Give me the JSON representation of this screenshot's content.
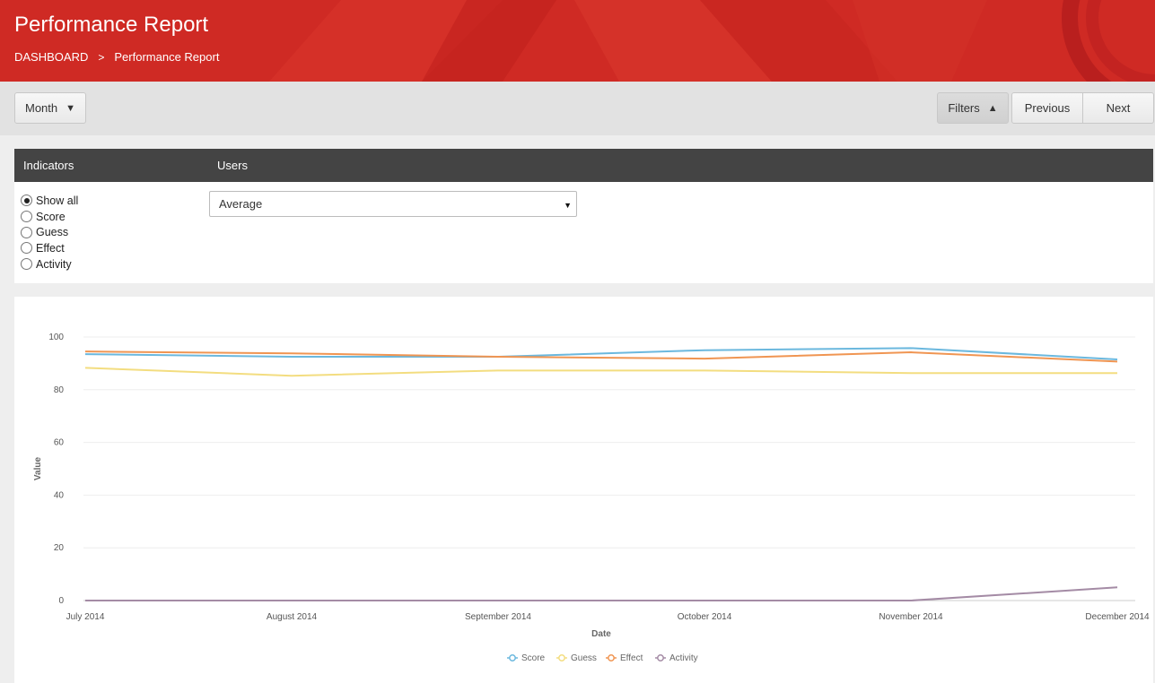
{
  "header": {
    "title": "Performance Report",
    "breadcrumb": {
      "root": "DASHBOARD",
      "separator": ">",
      "current": "Performance Report"
    }
  },
  "toolbar": {
    "period": "Month",
    "filters": "Filters",
    "previous": "Previous",
    "next": "Next"
  },
  "filters": {
    "indicators_header": "Indicators",
    "users_header": "Users",
    "indicators": [
      "Show all",
      "Score",
      "Guess",
      "Effect",
      "Activity"
    ],
    "selected_indicator": "Show all",
    "users_selected": "Average"
  },
  "colors": {
    "accent": "#cf2a24",
    "score": "#6bb8de",
    "guess": "#f3dd80",
    "effect": "#f09552",
    "activity": "#a48ba5"
  },
  "chart_data": {
    "type": "line",
    "categories": [
      "July 2014",
      "August 2014",
      "September 2014",
      "October 2014",
      "November 2014",
      "December 2014"
    ],
    "series": [
      {
        "name": "Score",
        "values": [
          93.5,
          92.5,
          92.5,
          95.0,
          95.8,
          91.5
        ]
      },
      {
        "name": "Guess",
        "values": [
          88.3,
          85.3,
          87.3,
          87.3,
          86.3,
          86.3
        ]
      },
      {
        "name": "Effect",
        "values": [
          94.5,
          93.8,
          92.5,
          91.8,
          94.2,
          90.7
        ]
      },
      {
        "name": "Activity",
        "values": [
          0,
          0,
          0,
          0,
          0,
          5
        ]
      }
    ],
    "xlabel": "Date",
    "ylabel": "Value",
    "ylim": [
      0,
      100
    ],
    "yticks": [
      0,
      20,
      40,
      60,
      80,
      100
    ],
    "grid": true,
    "legend": "bottom-center"
  }
}
